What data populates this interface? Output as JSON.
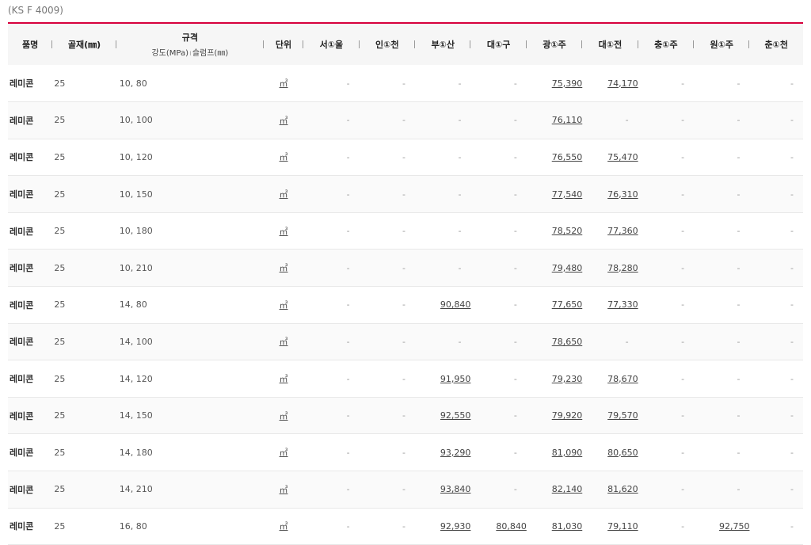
{
  "standard_label": "(KS F 4009)",
  "accent_color": "#d6003c",
  "headers": {
    "product": "품명",
    "aggregate": "골재(㎜)",
    "spec_title": "규격",
    "spec_sub_strength": "강도(MPa)",
    "spec_sub_slump": "슬럼프(㎜)",
    "unit": "단위",
    "regions": [
      "서①울",
      "인①천",
      "부①산",
      "대①구",
      "광①주",
      "대①전",
      "충①주",
      "원①주",
      "춘①천"
    ]
  },
  "rows": [
    {
      "product": "레미콘",
      "aggregate": "25",
      "spec": "10, 80",
      "unit": "㎥",
      "prices": [
        "-",
        "-",
        "-",
        "-",
        "75,390",
        "74,170",
        "-",
        "-",
        "-"
      ]
    },
    {
      "product": "레미콘",
      "aggregate": "25",
      "spec": "10, 100",
      "unit": "㎥",
      "prices": [
        "-",
        "-",
        "-",
        "-",
        "76,110",
        "-",
        "-",
        "-",
        "-"
      ]
    },
    {
      "product": "레미콘",
      "aggregate": "25",
      "spec": "10, 120",
      "unit": "㎥",
      "prices": [
        "-",
        "-",
        "-",
        "-",
        "76,550",
        "75,470",
        "-",
        "-",
        "-"
      ]
    },
    {
      "product": "레미콘",
      "aggregate": "25",
      "spec": "10, 150",
      "unit": "㎥",
      "prices": [
        "-",
        "-",
        "-",
        "-",
        "77,540",
        "76,310",
        "-",
        "-",
        "-"
      ]
    },
    {
      "product": "레미콘",
      "aggregate": "25",
      "spec": "10, 180",
      "unit": "㎥",
      "prices": [
        "-",
        "-",
        "-",
        "-",
        "78,520",
        "77,360",
        "-",
        "-",
        "-"
      ]
    },
    {
      "product": "레미콘",
      "aggregate": "25",
      "spec": "10, 210",
      "unit": "㎥",
      "prices": [
        "-",
        "-",
        "-",
        "-",
        "79,480",
        "78,280",
        "-",
        "-",
        "-"
      ]
    },
    {
      "product": "레미콘",
      "aggregate": "25",
      "spec": "14, 80",
      "unit": "㎥",
      "prices": [
        "-",
        "-",
        "90,840",
        "-",
        "77,650",
        "77,330",
        "-",
        "-",
        "-"
      ]
    },
    {
      "product": "레미콘",
      "aggregate": "25",
      "spec": "14, 100",
      "unit": "㎥",
      "prices": [
        "-",
        "-",
        "-",
        "-",
        "78,650",
        "-",
        "-",
        "-",
        "-"
      ]
    },
    {
      "product": "레미콘",
      "aggregate": "25",
      "spec": "14, 120",
      "unit": "㎥",
      "prices": [
        "-",
        "-",
        "91,950",
        "-",
        "79,230",
        "78,670",
        "-",
        "-",
        "-"
      ]
    },
    {
      "product": "레미콘",
      "aggregate": "25",
      "spec": "14, 150",
      "unit": "㎥",
      "prices": [
        "-",
        "-",
        "92,550",
        "-",
        "79,920",
        "79,570",
        "-",
        "-",
        "-"
      ]
    },
    {
      "product": "레미콘",
      "aggregate": "25",
      "spec": "14, 180",
      "unit": "㎥",
      "prices": [
        "-",
        "-",
        "93,290",
        "-",
        "81,090",
        "80,650",
        "-",
        "-",
        "-"
      ]
    },
    {
      "product": "레미콘",
      "aggregate": "25",
      "spec": "14, 210",
      "unit": "㎥",
      "prices": [
        "-",
        "-",
        "93,840",
        "-",
        "82,140",
        "81,620",
        "-",
        "-",
        "-"
      ]
    },
    {
      "product": "레미콘",
      "aggregate": "25",
      "spec": "16, 80",
      "unit": "㎥",
      "prices": [
        "-",
        "-",
        "92,930",
        "80,840",
        "81,030",
        "79,110",
        "-",
        "92,750",
        "-"
      ]
    }
  ]
}
